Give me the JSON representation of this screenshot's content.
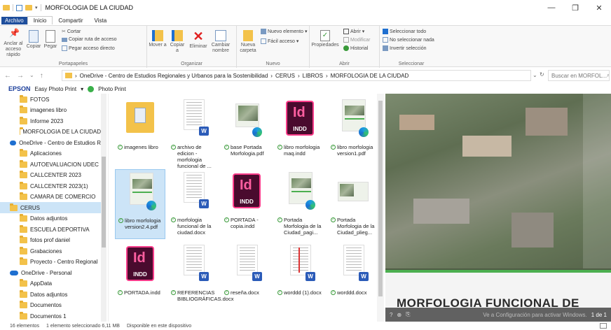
{
  "window": {
    "title": "MORFOLOGIA DE LA CIUDAD"
  },
  "tabs": [
    {
      "label": "Archivo"
    },
    {
      "label": "Inicio"
    },
    {
      "label": "Compartir"
    },
    {
      "label": "Vista"
    }
  ],
  "ribbon": {
    "portapapeles": {
      "anclar": "Anclar al acceso rápido",
      "copiar": "Copiar",
      "pegar": "Pegar",
      "cortar": "Cortar",
      "copiar_ruta": "Copiar ruta de acceso",
      "pegar_acceso": "Pegar acceso directo",
      "label": "Portapapeles"
    },
    "organizar": {
      "mover": "Mover a",
      "copiar": "Copiar a",
      "eliminar": "Eliminar",
      "cambiar": "Cambiar nombre",
      "label": "Organizar"
    },
    "nuevo": {
      "nueva_carpeta": "Nueva carpeta",
      "nuevo_elemento": "Nuevo elemento",
      "facil_acceso": "Fácil acceso",
      "label": "Nuevo"
    },
    "abrir": {
      "propiedades": "Propiedades",
      "abrir": "Abrir",
      "modificar": "Modificar",
      "historial": "Historial",
      "label": "Abrir"
    },
    "seleccionar": {
      "todo": "Seleccionar todo",
      "nada": "No seleccionar nada",
      "invertir": "Invertir selección",
      "label": "Seleccionar"
    }
  },
  "address": {
    "segments": [
      "OneDrive - Centro de Estudios Regionales y Urbanos para la Sostenibilidad",
      "CERUS",
      "LIBROS",
      "MORFOLOGIA DE LA CIUDAD"
    ],
    "search_placeholder": "Buscar en MORFOL..."
  },
  "epson": {
    "brand": "EPSON",
    "app": "Easy Photo Print",
    "photo": "Photo Print"
  },
  "nav_items": [
    {
      "label": "FOTOS",
      "type": "folder"
    },
    {
      "label": "imagenes libro",
      "type": "folder"
    },
    {
      "label": "Informe 2023",
      "type": "folder"
    },
    {
      "label": "MORFOLOGIA DE LA CIUDAD",
      "type": "folder"
    },
    {
      "label": "OneDrive - Centro de Estudios R",
      "type": "cloud"
    },
    {
      "label": "Aplicaciones",
      "type": "folder"
    },
    {
      "label": "AUTOEVALUACION UDEC",
      "type": "folder"
    },
    {
      "label": "CALLCENTER 2023",
      "type": "folder"
    },
    {
      "label": "CALLCENTER 2023(1)",
      "type": "folder"
    },
    {
      "label": "CAMARA DE COMERCIO",
      "type": "folder"
    },
    {
      "label": "CERUS",
      "type": "folder"
    },
    {
      "label": "Datos adjuntos",
      "type": "folder"
    },
    {
      "label": "ESCUELA DEPORTIVA",
      "type": "folder"
    },
    {
      "label": "fotos prof daniel",
      "type": "folder"
    },
    {
      "label": "Grabaciones",
      "type": "folder"
    },
    {
      "label": "Proyecto - Centro Regional",
      "type": "folder"
    },
    {
      "label": "OneDrive - Personal",
      "type": "cloud"
    },
    {
      "label": "AppData",
      "type": "folder"
    },
    {
      "label": "Datos adjuntos",
      "type": "folder"
    },
    {
      "label": "Documentos",
      "type": "folder"
    },
    {
      "label": "Documentos 1",
      "type": "folder"
    }
  ],
  "files": [
    {
      "name": "imagenes libro",
      "kind": "folder"
    },
    {
      "name": "archivo de edicion - morfologia funcional de ...",
      "kind": "word"
    },
    {
      "name": "base Portada Morfologia.pdf",
      "kind": "pdf-photo"
    },
    {
      "name": "libro morfologia maq.indd",
      "kind": "indd"
    },
    {
      "name": "libro morfologia version1.pdf",
      "kind": "pdf-cover"
    },
    {
      "name": "libro morfologia version2.4.pdf",
      "kind": "pdf-cover",
      "selected": true
    },
    {
      "name": "morfologia funcional de la ciudad.docx",
      "kind": "word"
    },
    {
      "name": "PORTADA - copia.indd",
      "kind": "indd"
    },
    {
      "name": "Portada Morfologia de la Ciudad_pagi...",
      "kind": "pdf-cover"
    },
    {
      "name": "Portada Morfologia de la Ciudad_plieg...",
      "kind": "pdf-wide"
    },
    {
      "name": "PORTADA.indd",
      "kind": "indd"
    },
    {
      "name": "REFERENCIAS BIBLIOGRÁFICAS.docx",
      "kind": "word"
    },
    {
      "name": "reseña.docx",
      "kind": "word"
    },
    {
      "name": "worddd (1).docx",
      "kind": "word-red"
    },
    {
      "name": "worddd.docx",
      "kind": "word"
    }
  ],
  "preview": {
    "title": "MORFOLOGIA FUNCIONAL DE",
    "activate": "Ve a Configuración para activar Windows.",
    "page": "1 de 1"
  },
  "status": {
    "count": "16 elementos",
    "selection": "1 elemento seleccionado  6,11 MB",
    "availability": "Disponible en este dispositivo"
  },
  "colors": {
    "accent": "#1e4e9c",
    "selection": "#cce4f7",
    "indesign": "#ff3d8b"
  }
}
